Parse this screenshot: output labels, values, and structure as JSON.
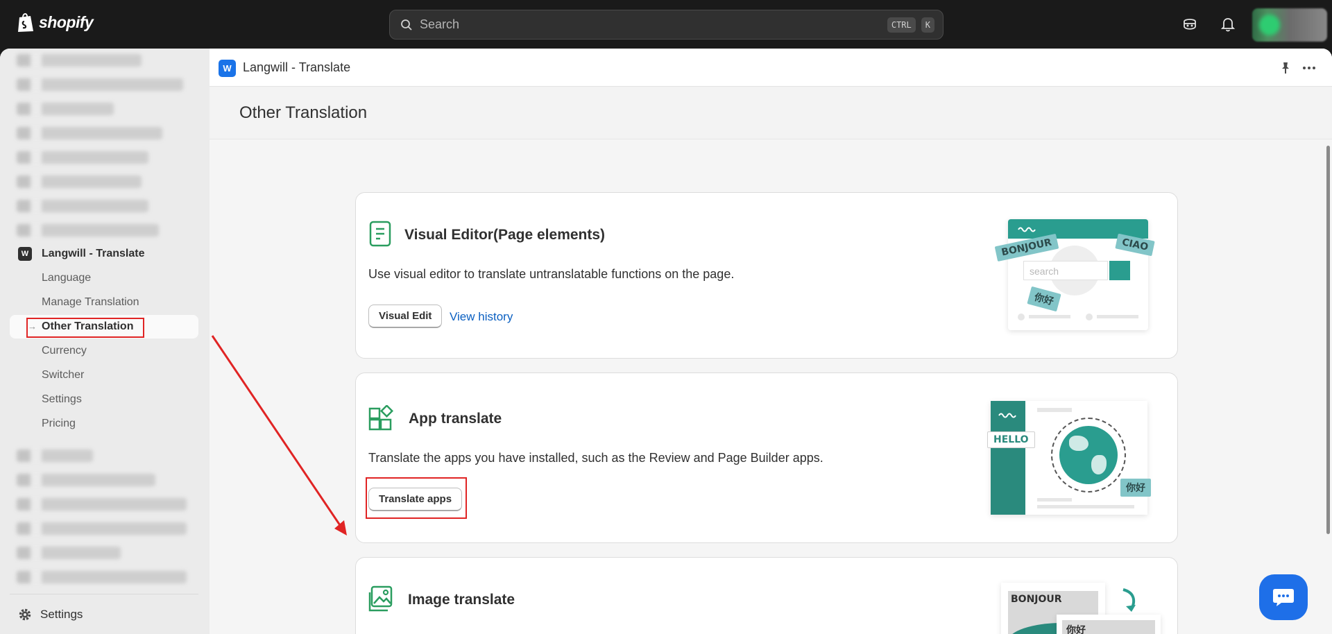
{
  "topbar": {
    "brand": "shopify",
    "search_placeholder": "Search",
    "shortcut_ctrl": "CTRL",
    "shortcut_k": "K"
  },
  "sidebar": {
    "app_name": "Langwill - Translate",
    "items": [
      {
        "label": "Language"
      },
      {
        "label": "Manage Translation"
      },
      {
        "label": "Other Translation"
      },
      {
        "label": "Currency"
      },
      {
        "label": "Switcher"
      },
      {
        "label": "Settings"
      },
      {
        "label": "Pricing"
      }
    ],
    "footer_settings": "Settings"
  },
  "appbar": {
    "title": "Langwill - Translate"
  },
  "page": {
    "title": "Other Translation"
  },
  "cards": [
    {
      "title": "Visual Editor(Page elements)",
      "description": "Use visual editor to translate untranslatable functions on the page.",
      "button": "Visual Edit",
      "link": "View history",
      "illustration": {
        "tags": [
          "BONJOUR",
          "CIAO",
          "你好"
        ],
        "search": "search"
      }
    },
    {
      "title": "App translate",
      "description": "Translate the apps you have installed, such as the Review and Page Builder apps.",
      "button": "Translate apps",
      "illustration": {
        "tags": [
          "HELLO",
          "你好"
        ]
      }
    },
    {
      "title": "Image translate",
      "illustration": {
        "tags": [
          "BONJOUR",
          "你好"
        ]
      }
    }
  ],
  "colors": {
    "accent": "#1e6fe8",
    "highlight": "#e02424",
    "teal": "#2a9d8f",
    "link": "#0a5fc1"
  }
}
